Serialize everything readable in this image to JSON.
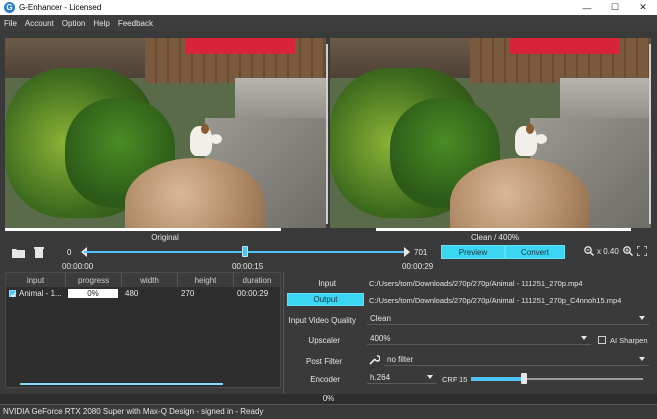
{
  "window": {
    "title": "G-Enhancer - Licensed",
    "logo_letter": "G",
    "minimize": "—",
    "maximize": "☐",
    "close": "✕"
  },
  "menu": [
    "File",
    "Account",
    "Option",
    "Help",
    "Feedback"
  ],
  "preview": {
    "left_label": "Original",
    "right_label": "Clean / 400%"
  },
  "timeline": {
    "start_frame": "0",
    "end_frame": "701",
    "current_position_fraction": 0.5,
    "time_start": "00:00:00",
    "time_current": "00:00:15",
    "time_end": "00:00:29"
  },
  "buttons": {
    "preview": "Preview",
    "convert": "Convert"
  },
  "zoom": {
    "label": "x 0.40"
  },
  "table": {
    "headers": [
      "input",
      "progress",
      "width",
      "height",
      "duration"
    ],
    "rows": [
      {
        "input": "Animal - 1...",
        "progress": "0%",
        "width": "480",
        "height": "270",
        "duration": "00:00:29",
        "checked": true
      }
    ]
  },
  "form": {
    "input_label": "Input",
    "input_value": "C:/Users/tom/Downloads/270p/270p/Animal - 111251_270p.mp4",
    "output_button": "Output",
    "output_value": "C:/Users/tom/Downloads/270p/270p/Animal - 111251_270p_C4nnoh15.mp4",
    "quality_label": "Input Video Quality",
    "quality_value": "Clean",
    "upscaler_label": "Upscaler",
    "upscaler_value": "400%",
    "ai_sharpen_label": "AI Sharpen",
    "postfilter_label": "Post Filter",
    "postfilter_value": "no filter",
    "encoder_label": "Encoder",
    "encoder_value": "h.264",
    "crf_label": "CRF",
    "crf_value": "15"
  },
  "progress": {
    "text": "0%"
  },
  "status": {
    "text": "NVIDIA GeForce RTX 2080 Super with Max-Q Design - signed in - Ready"
  },
  "colors": {
    "accent": "#3ad6f2",
    "slider": "#4fc3f7",
    "background": "#3a3a3a"
  }
}
